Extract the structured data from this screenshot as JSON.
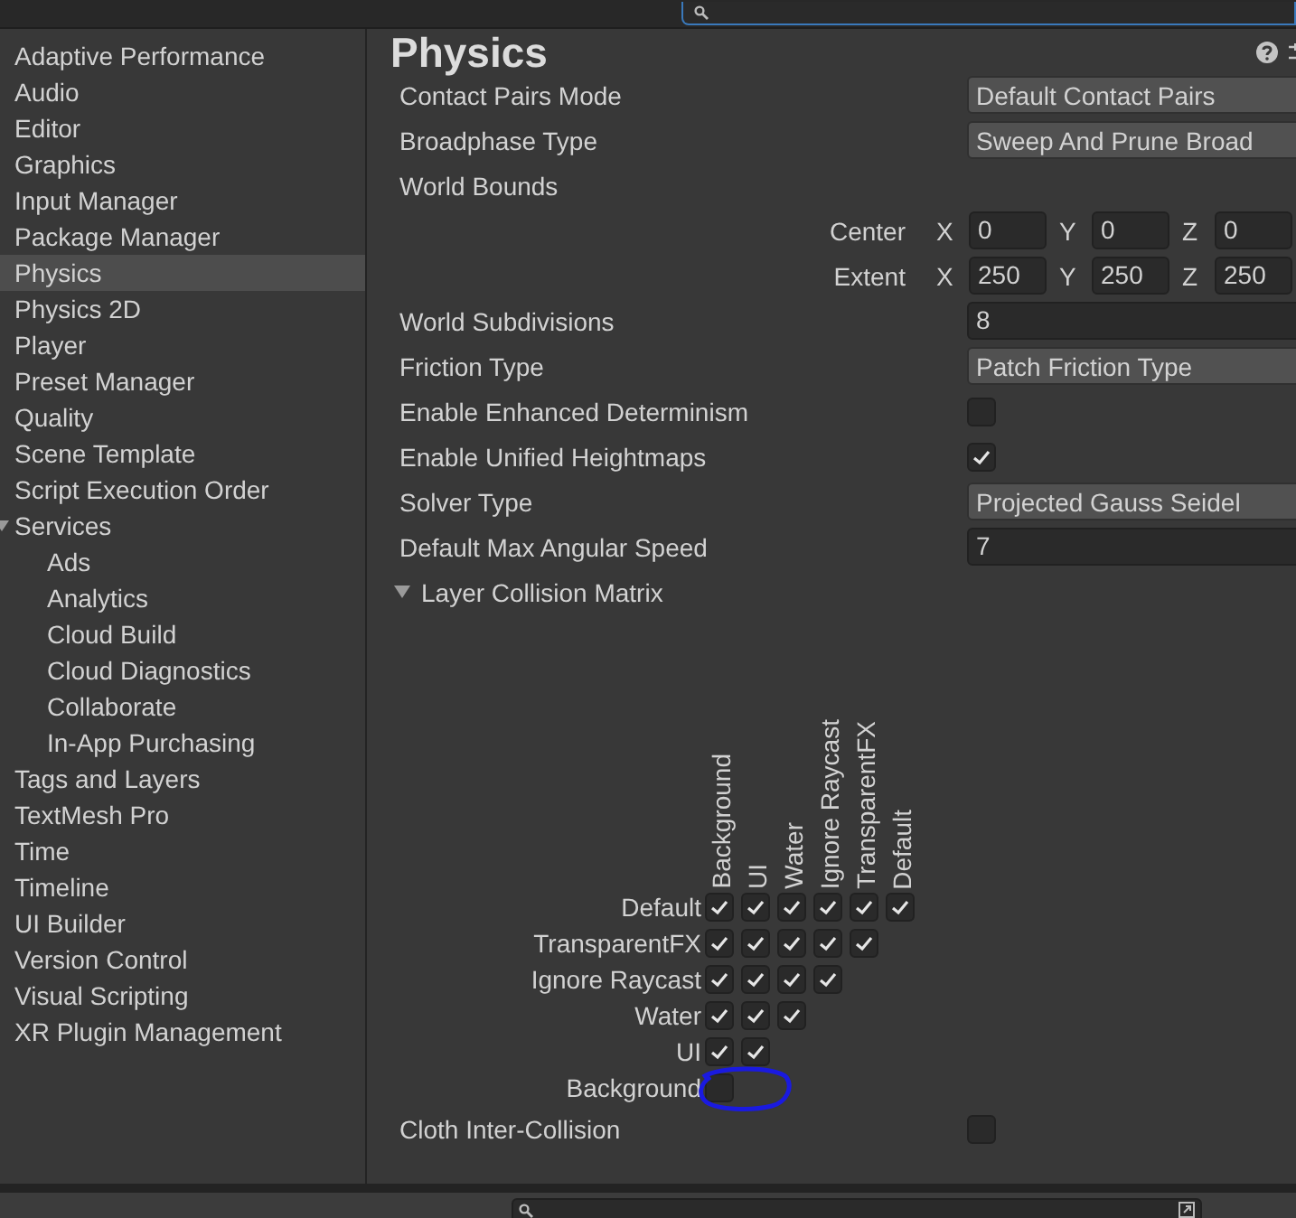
{
  "sidebar": {
    "items": [
      {
        "label": "Adaptive Performance",
        "selected": false
      },
      {
        "label": "Audio",
        "selected": false
      },
      {
        "label": "Editor",
        "selected": false
      },
      {
        "label": "Graphics",
        "selected": false
      },
      {
        "label": "Input Manager",
        "selected": false
      },
      {
        "label": "Package Manager",
        "selected": false
      },
      {
        "label": "Physics",
        "selected": true
      },
      {
        "label": "Physics 2D",
        "selected": false
      },
      {
        "label": "Player",
        "selected": false
      },
      {
        "label": "Preset Manager",
        "selected": false
      },
      {
        "label": "Quality",
        "selected": false
      },
      {
        "label": "Scene Template",
        "selected": false
      },
      {
        "label": "Script Execution Order",
        "selected": false
      },
      {
        "label": "Services",
        "selected": false,
        "expanded": true,
        "children": [
          {
            "label": "Ads",
            "selected": false
          },
          {
            "label": "Analytics",
            "selected": false
          },
          {
            "label": "Cloud Build",
            "selected": false
          },
          {
            "label": "Cloud Diagnostics",
            "selected": false
          },
          {
            "label": "Collaborate",
            "selected": false
          },
          {
            "label": "In-App Purchasing",
            "selected": false
          }
        ]
      },
      {
        "label": "Tags and Layers",
        "selected": false
      },
      {
        "label": "TextMesh Pro",
        "selected": false
      },
      {
        "label": "Time",
        "selected": false
      },
      {
        "label": "Timeline",
        "selected": false
      },
      {
        "label": "UI Builder",
        "selected": false
      },
      {
        "label": "Version Control",
        "selected": false
      },
      {
        "label": "Visual Scripting",
        "selected": false
      },
      {
        "label": "XR Plugin Management",
        "selected": false
      }
    ]
  },
  "panel": {
    "title": "Physics",
    "rows": [
      {
        "kind": "dropdown",
        "label": "Contact Pairs Mode",
        "value": "Default Contact Pairs"
      },
      {
        "kind": "dropdown",
        "label": "Broadphase Type",
        "value": "Sweep And Prune Broad"
      },
      {
        "kind": "group",
        "label": "World Bounds"
      },
      {
        "kind": "vector",
        "label": "Center",
        "components": [
          {
            "axis": "X",
            "value": "0"
          },
          {
            "axis": "Y",
            "value": "0"
          },
          {
            "axis": "Z",
            "value": "0"
          }
        ]
      },
      {
        "kind": "vector",
        "label": "Extent",
        "components": [
          {
            "axis": "X",
            "value": "250"
          },
          {
            "axis": "Y",
            "value": "250"
          },
          {
            "axis": "Z",
            "value": "250"
          }
        ]
      },
      {
        "kind": "number",
        "label": "World Subdivisions",
        "value": "8"
      },
      {
        "kind": "dropdown",
        "label": "Friction Type",
        "value": "Patch Friction Type"
      },
      {
        "kind": "checkbox",
        "label": "Enable Enhanced Determinism",
        "checked": false
      },
      {
        "kind": "checkbox",
        "label": "Enable Unified Heightmaps",
        "checked": true
      },
      {
        "kind": "dropdown",
        "label": "Solver Type",
        "value": "Projected Gauss Seidel"
      },
      {
        "kind": "number",
        "label": "Default Max Angular Speed",
        "value": "7"
      },
      {
        "kind": "foldout",
        "label": "Layer Collision Matrix",
        "expanded": true
      },
      {
        "kind": "matrix",
        "columns": [
          "Background",
          "UI",
          "Water",
          "Ignore Raycast",
          "TransparentFX",
          "Default"
        ],
        "rows": [
          {
            "label": "Default",
            "cells": [
              {
                "checked": true
              },
              {
                "checked": true
              },
              {
                "checked": true
              },
              {
                "checked": true
              },
              {
                "checked": true
              },
              {
                "checked": true
              }
            ]
          },
          {
            "label": "TransparentFX",
            "cells": [
              {
                "checked": true
              },
              {
                "checked": true
              },
              {
                "checked": true
              },
              {
                "checked": true
              },
              {
                "checked": true
              }
            ]
          },
          {
            "label": "Ignore Raycast",
            "cells": [
              {
                "checked": true
              },
              {
                "checked": true
              },
              {
                "checked": true
              },
              {
                "checked": true
              }
            ]
          },
          {
            "label": "Water",
            "cells": [
              {
                "checked": true
              },
              {
                "checked": true
              },
              {
                "checked": true
              }
            ]
          },
          {
            "label": "UI",
            "cells": [
              {
                "checked": true
              },
              {
                "checked": true
              }
            ]
          },
          {
            "label": "Background",
            "cells": [
              {
                "checked": false
              }
            ]
          }
        ]
      },
      {
        "kind": "checkbox",
        "label": "Cloth Inter-Collision",
        "checked": false
      }
    ]
  }
}
